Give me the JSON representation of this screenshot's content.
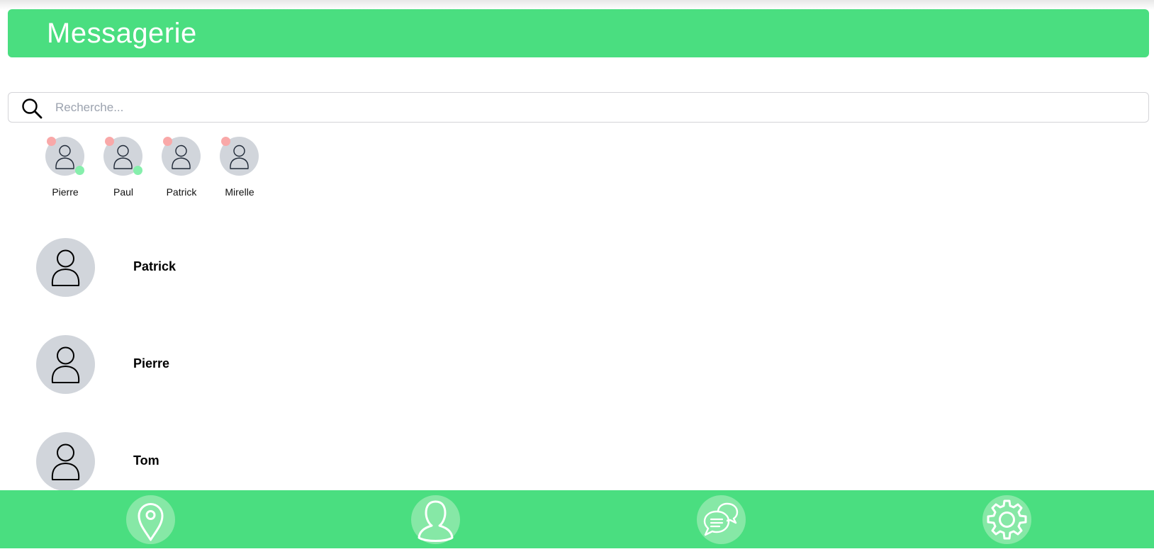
{
  "header": {
    "title": "Messagerie"
  },
  "search": {
    "placeholder": "Recherche...",
    "value": ""
  },
  "stories": [
    {
      "name": "Pierre",
      "online": true,
      "unread": true
    },
    {
      "name": "Paul",
      "online": true,
      "unread": true
    },
    {
      "name": "Patrick",
      "online": false,
      "unread": true
    },
    {
      "name": "Mirelle",
      "online": false,
      "unread": true
    }
  ],
  "conversations": [
    {
      "name": "Patrick"
    },
    {
      "name": "Pierre"
    },
    {
      "name": "Tom"
    }
  ],
  "bottom_nav": [
    {
      "icon": "location-pin-icon"
    },
    {
      "icon": "user-profile-icon"
    },
    {
      "icon": "chat-bubbles-icon"
    },
    {
      "icon": "settings-gear-icon"
    }
  ],
  "colors": {
    "accent": "#4ade80",
    "nav_button": "#86e8a6",
    "avatar_bg": "#d1d5db",
    "unread_dot": "#f9a8a8",
    "online_dot": "#86efac"
  }
}
